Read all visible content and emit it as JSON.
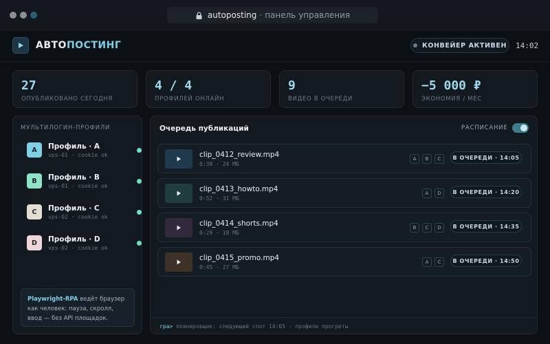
{
  "browser": {
    "host": "autoposting",
    "separator": "·",
    "path": "панель управления"
  },
  "header": {
    "brand_part1": "АВТО",
    "brand_part2": "ПОСТИНГ",
    "pipeline_status": "КОНВЕЙЕР АКТИВЕН",
    "time": "14:02"
  },
  "stats": [
    {
      "value": "27",
      "label": "ОПУБЛИКОВАНО СЕГОДНЯ"
    },
    {
      "value": "4 / 4",
      "label": "ПРОФИЛЕЙ ОНЛАЙН"
    },
    {
      "value": "9",
      "label": "ВИДЕО В ОЧЕРЕДИ"
    },
    {
      "value": "−5 000 ₽",
      "label": "ЭКОНОМИЯ / МЕС"
    }
  ],
  "profiles": {
    "title": "МУЛЬТИЛОГИН-ПРОФИЛИ",
    "items": [
      {
        "letter": "A",
        "name": "Профиль · A",
        "meta": "vps-01 · cookie ok",
        "color": "#7fd0e6"
      },
      {
        "letter": "B",
        "name": "Профиль · B",
        "meta": "vps-01 · cookie ok",
        "color": "#8fe3c6"
      },
      {
        "letter": "C",
        "name": "Профиль · C",
        "meta": "vps-02 · cookie ok",
        "color": "#e3ddd2"
      },
      {
        "letter": "D",
        "name": "Профиль · D",
        "meta": "vps-02 · cookie ok",
        "color": "#ecd6d8"
      }
    ],
    "note_bold": "Playwright-RPA",
    "note_text": " ведёт браузер как человек: пауза, скролл, ввод — без API площадок."
  },
  "queue": {
    "title": "Очередь публикаций",
    "schedule_label": "РАСПИСАНИЕ",
    "schedule_enabled": true,
    "items": [
      {
        "file": "clip_0412_review.mp4",
        "meta": "0:38 · 24 МБ",
        "tags": [
          "A",
          "B",
          "C"
        ],
        "status": "В ОЧЕРЕДИ · 14:05",
        "thumb": "#1f3a4c"
      },
      {
        "file": "clip_0413_howto.mp4",
        "meta": "0:52 · 31 МБ",
        "tags": [
          "A",
          "D"
        ],
        "status": "В ОЧЕРЕДИ · 14:20",
        "thumb": "#1f3c3e"
      },
      {
        "file": "clip_0414_shorts.mp4",
        "meta": "0:29 · 18 МБ",
        "tags": [
          "B",
          "C",
          "D"
        ],
        "status": "В ОЧЕРЕДИ · 14:35",
        "thumb": "#302a3a"
      },
      {
        "file": "clip_0415_promo.mp4",
        "meta": "0:45 · 27 МБ",
        "tags": [
          "A",
          "C"
        ],
        "status": "В ОЧЕРЕДИ · 14:50",
        "thumb": "#3e3226"
      }
    ],
    "terminal_prompt": "rpa>",
    "terminal_text": "планировщик: следующий слот 14:05 · профили прогреты"
  }
}
